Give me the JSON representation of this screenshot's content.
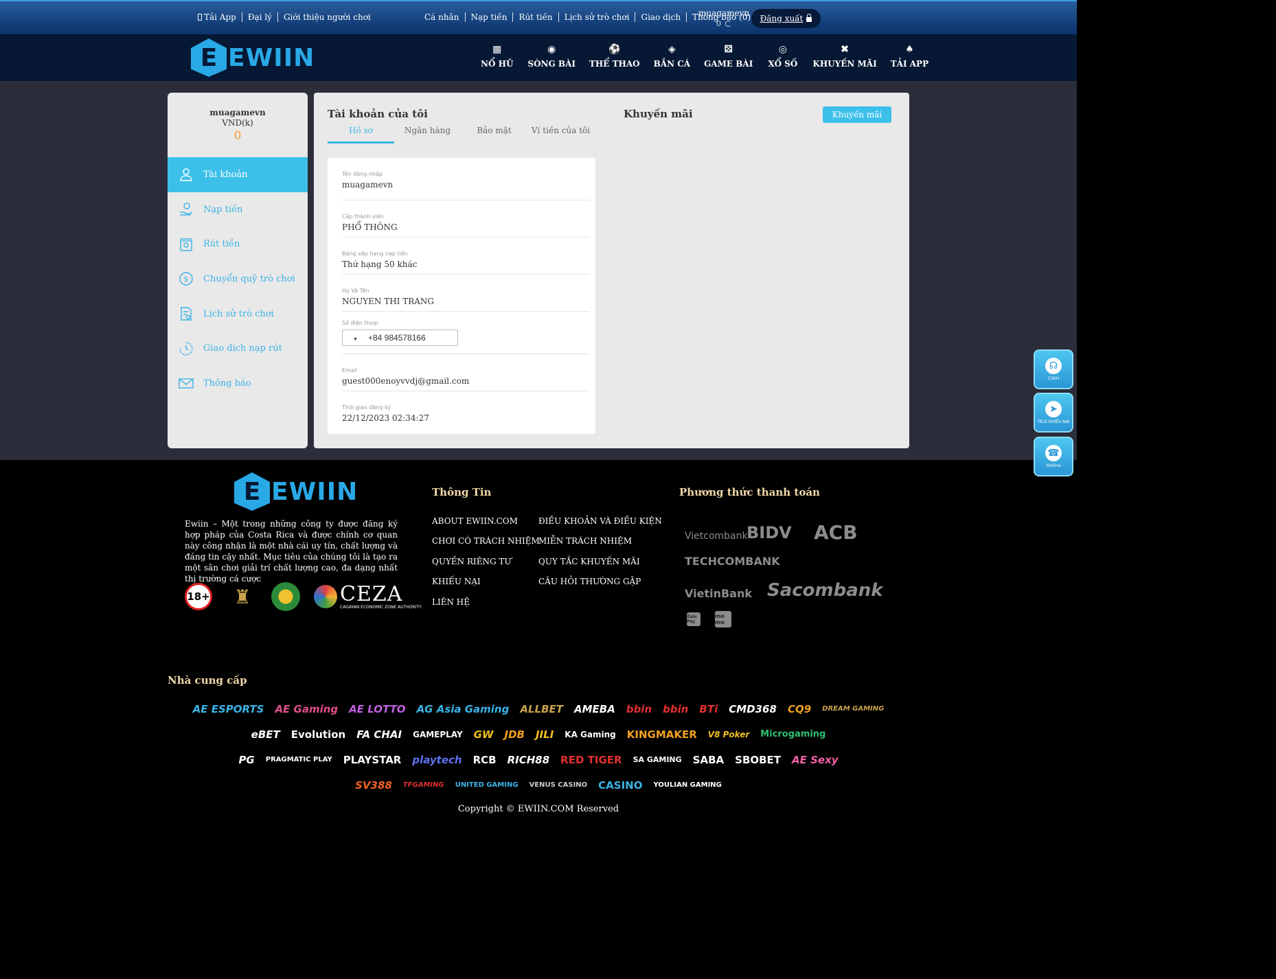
{
  "topbar": {
    "left_links": [
      "Tải App",
      "Đại lý",
      "Giới thiệu người chơi"
    ],
    "right_links": [
      "Cá nhân",
      "Nạp tiền",
      "Rút tiền",
      "Lịch sử trò chơi",
      "Giao dịch",
      "Thông báo (0)"
    ],
    "username": "muagamevn",
    "balance": "0",
    "logout_label": "Đăng xuất"
  },
  "brand": {
    "logo_letter": "E",
    "logo_word": "EWIIN"
  },
  "nav": {
    "items": [
      {
        "label": "NỔ HŨ",
        "icon": "slot-icon"
      },
      {
        "label": "SÒNG BÀI",
        "icon": "casino-chip-icon"
      },
      {
        "label": "THỂ THAO",
        "icon": "soccer-ball-icon"
      },
      {
        "label": "BẮN CÁ",
        "icon": "fish-icon"
      },
      {
        "label": "GAME BÀI",
        "icon": "dice-icon"
      },
      {
        "label": "XỔ SỐ",
        "icon": "lottery-ball-icon"
      },
      {
        "label": "KHUYẾN MÃI",
        "icon": "ticket-icon"
      },
      {
        "label": "TẢI APP",
        "icon": "spade-icon"
      }
    ]
  },
  "sidebar": {
    "username": "muagamevn",
    "currency": "VND(k)",
    "amount": "0",
    "items": [
      {
        "label": "Tài khoản",
        "icon": "user-icon"
      },
      {
        "label": "Nạp tiền",
        "icon": "deposit-icon"
      },
      {
        "label": "Rút tiền",
        "icon": "withdraw-icon"
      },
      {
        "label": "Chuyển quỹ trò chơi",
        "icon": "dollar-circle-icon"
      },
      {
        "label": "Lịch sử trò chơi",
        "icon": "history-doc-icon"
      },
      {
        "label": "Giao dịch nạp rút",
        "icon": "clock-icon"
      },
      {
        "label": "Thông báo",
        "icon": "envelope-icon"
      }
    ]
  },
  "account": {
    "title": "Tài khoản của tôi",
    "tabs": [
      "Hồ sơ",
      "Ngân hàng",
      "Bảo mật",
      "Ví tiền của tôi"
    ],
    "fields": {
      "username_label": "Tên đăng nhập",
      "username": "muagamevn",
      "level_label": "Cấp thành viên",
      "level": "PHỔ THÔNG",
      "rank_label": "Bảng xếp hạng nạp tiền",
      "rank": "Thứ hạng 50 khác",
      "fullname_label": "Họ Và Tên",
      "fullname": "NGUYEN THI TRANG",
      "phone_label": "Số điện thoại",
      "phone": "+84 984578166",
      "email_label": "Email",
      "email": "guest000enoyvvdj@gmail.com",
      "regtime_label": "Thời gian đăng ký",
      "regtime": "22/12/2023 02:34:27"
    }
  },
  "promo": {
    "title": "Khuyến mãi",
    "button": "Khuyến mãi"
  },
  "floating": [
    {
      "label": "CSKH",
      "icon": "headset-icon"
    },
    {
      "label": "TELE KHIẾU NẠI",
      "icon": "telegram-icon"
    },
    {
      "label": "Hotline",
      "icon": "phone-icon"
    }
  ],
  "footer": {
    "description": "Ewiin – Một trong những công ty được đăng ký hợp pháp của Costa Rica và được chính cơ quan này công nhận là một nhà cái uy tín, chất lượng và đáng tin cậy nhất. Mục tiêu của chúng tôi là tạo ra một sân chơi giải trí chất lượng cao, đa dạng nhất thị trường cá cược",
    "badge_age": "18+",
    "ceza": "CEZA",
    "ceza_full": "CAGAYAN ECONOMIC ZONE AUTHORITY",
    "info_title": "Thông Tin",
    "info_col1": [
      "ABOUT EWIIN.COM",
      "CHƠI CÓ TRÁCH NHIỆM",
      "QUYỀN RIÊNG TƯ",
      "KHIẾU NẠI",
      "LIÊN HỆ"
    ],
    "info_col2": [
      "ĐIỀU KHOẢN VÀ ĐIỀU KIỆN",
      "MIỄN TRÁCH NHIỆM",
      "QUY TẮC KHUYẾN MÃI",
      "CÂU HỎI THƯỜNG GẶP"
    ],
    "payment_title": "Phương thức thanh toán",
    "banks": [
      "Vietcombank",
      "BIDV",
      "ACB",
      "TECHCOMBANK",
      "VietinBank",
      "Sacombank"
    ],
    "wallets": [
      "Zalo Pay",
      "mo mo"
    ],
    "providers_title": "Nhà cung cấp",
    "providers": [
      [
        "AE ESPORTS",
        "AE Gaming",
        "AE LOTTO",
        "AG Asia Gaming",
        "ALLBET",
        "AMEBA",
        "bbin",
        "bbin",
        "BTi",
        "CMD368",
        "CQ9",
        "DREAM GAMING"
      ],
      [
        "eBET",
        "Evolution",
        "FA CHAI",
        "GAMEPLAY",
        "GW",
        "JDB",
        "JILI",
        "KA Gaming",
        "KINGMAKER",
        "V8 Poker",
        "Microgaming"
      ],
      [
        "PG",
        "PRAGMATIC PLAY",
        "PLAYSTAR",
        "playtech",
        "RCB",
        "RICH88",
        "RED TIGER",
        "SA GAMING",
        "SABA",
        "SBOBET",
        "AE Sexy"
      ],
      [
        "SV388",
        "TFGAMING",
        "UNITED GAMING",
        "VENUS CASINO",
        "CASINO",
        "YOULIAN GAMING"
      ]
    ],
    "copyright": "Copyright © EWIIN.COM Reserved"
  },
  "colors": {
    "accent": "#3cc0ea",
    "gold": "#f0d7a8",
    "orange": "#f39c2a"
  }
}
